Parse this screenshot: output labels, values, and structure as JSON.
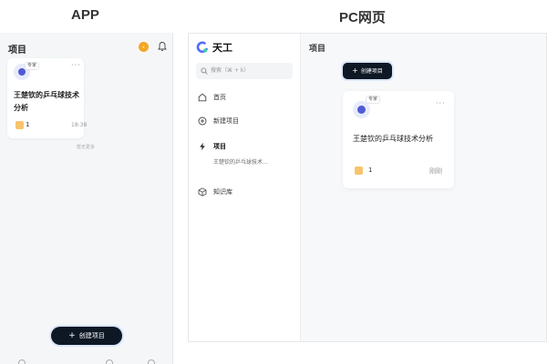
{
  "labels": {
    "app": "APP",
    "pc": "PC网页"
  },
  "colors": {
    "accent_dark": "#0e1724",
    "avatar_blue": "#4f5bd5",
    "notify_orange": "#f5a623"
  },
  "app": {
    "header": {
      "title": "项目"
    },
    "card": {
      "tag": "专家",
      "name": "王楚钦的乒乓球技术分析",
      "count": "1",
      "time": "18:38"
    },
    "more_text": "暂无更多",
    "create_button": "创建项目"
  },
  "pc": {
    "brand": "天工",
    "search_placeholder": "搜索（⌘ + k）",
    "nav": {
      "home": "首页",
      "new_project": "新建项目",
      "projects": "项目",
      "projects_sub": "王楚钦的乒乓球技术…",
      "knowledge": "知识库"
    },
    "main": {
      "title": "项目",
      "create_button": "创建项目",
      "card": {
        "tag": "专家",
        "name": "王楚钦的乒乓球技术分析",
        "count": "1",
        "time": "刚刚"
      }
    }
  },
  "icons": [
    "more-icon",
    "bell-icon",
    "search-icon",
    "home-icon",
    "plus-circle-icon",
    "lightning-icon",
    "cube-icon",
    "logo-icon"
  ]
}
